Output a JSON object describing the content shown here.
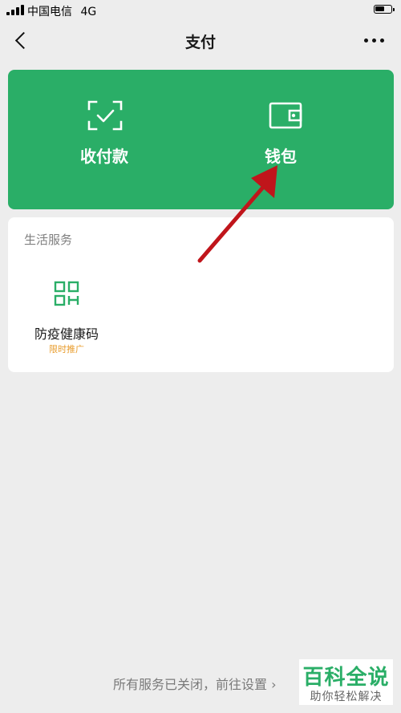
{
  "status_bar": {
    "carrier": "中国电信",
    "network": "4G"
  },
  "nav": {
    "title": "支付",
    "back_icon": "chevron-left-icon",
    "more_icon": "more-horizontal-icon"
  },
  "pay_card": {
    "background": "#2aae67",
    "items": [
      {
        "label": "收付款",
        "icon": "scan-check-icon"
      },
      {
        "label": "钱包",
        "icon": "wallet-icon"
      }
    ]
  },
  "life_services": {
    "title": "生活服务",
    "items": [
      {
        "name": "防疫健康码",
        "badge": "限时推广",
        "icon": "qr-code-icon",
        "icon_color": "#2aae67",
        "badge_color": "#e89c2c"
      }
    ]
  },
  "footer": {
    "text": "所有服务已关闭，前往设置 ›"
  },
  "watermark": {
    "title": "百科全说",
    "subtitle": "助你轻松解决"
  },
  "annotation": {
    "color": "#c0151b",
    "target": "钱包"
  }
}
